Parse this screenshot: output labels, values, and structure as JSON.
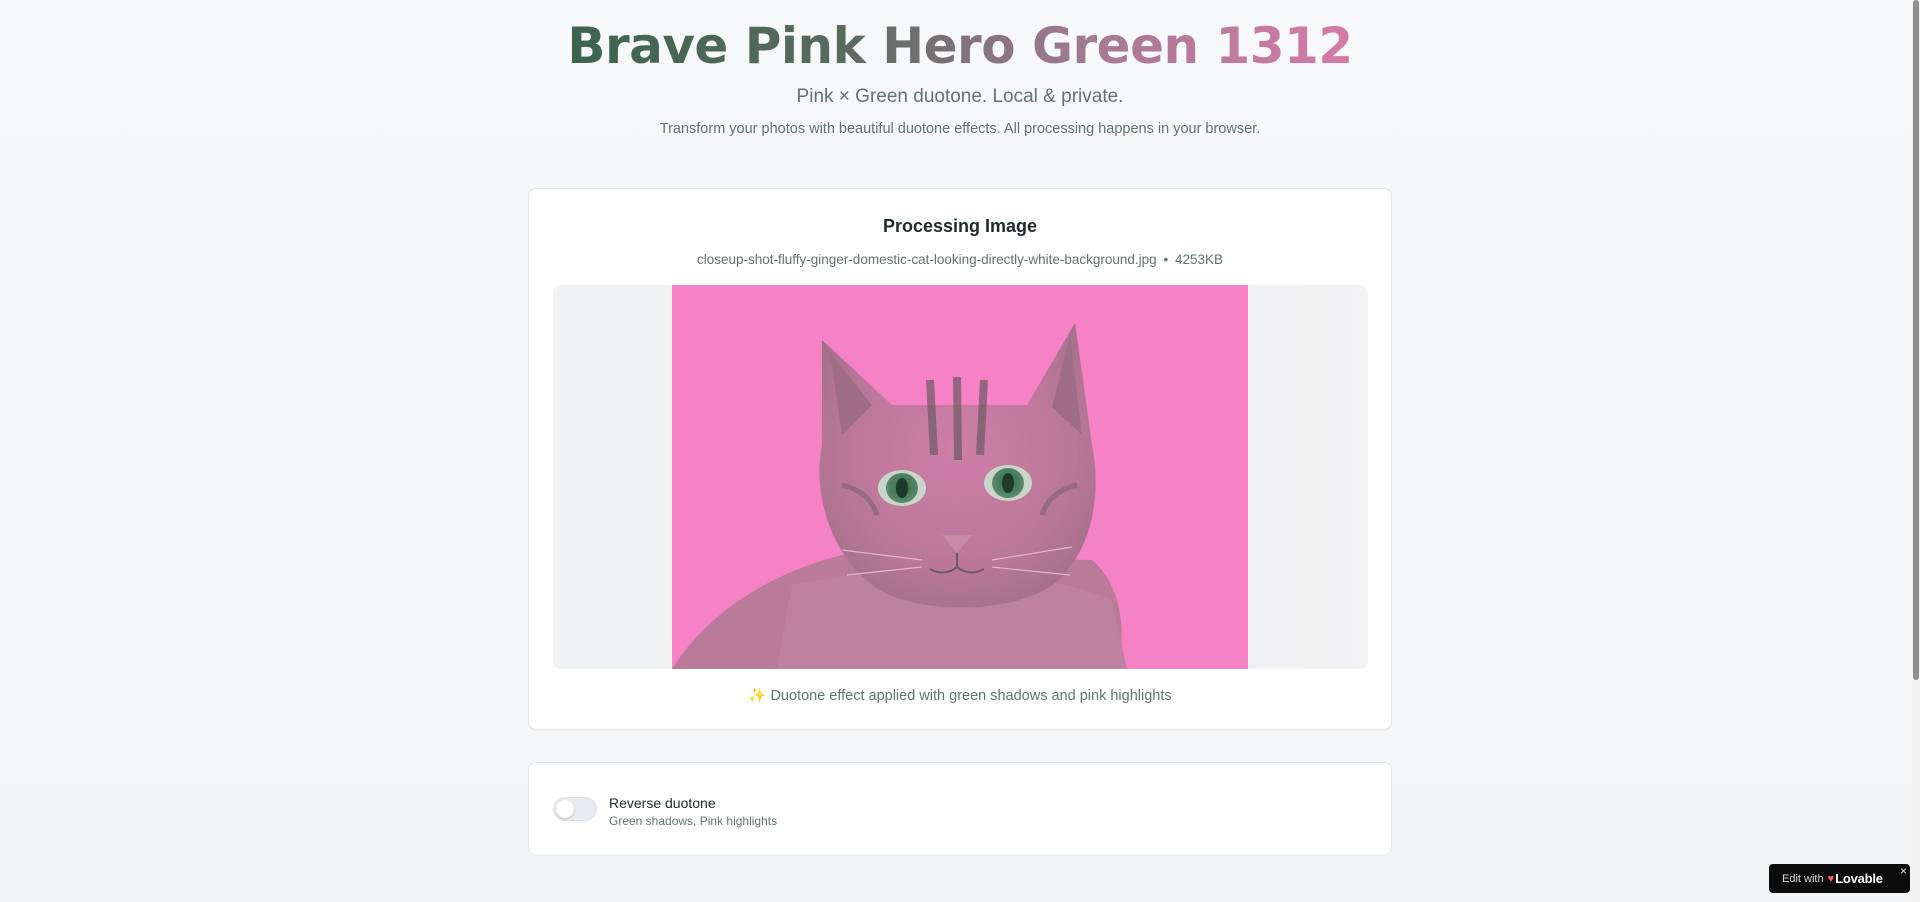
{
  "header": {
    "title": "Brave Pink Hero Green 1312",
    "tagline": "Pink × Green duotone. Local & private.",
    "description": "Transform your photos with beautiful duotone effects. All processing happens in your browser."
  },
  "processing": {
    "title": "Processing Image",
    "file_name": "closeup-shot-fluffy-ginger-domestic-cat-looking-directly-white-background.jpg",
    "separator": "•",
    "file_size": "4253KB",
    "caption_icon": "✨",
    "caption": "Duotone effect applied with green shadows and pink highlights",
    "image_alt": "cat"
  },
  "settings": {
    "toggle_label": "Reverse duotone",
    "toggle_hint": "Green shadows, Pink highlights",
    "toggle_on": false
  },
  "badge": {
    "prefix": "Edit with",
    "brand": "Lovable",
    "close": "×"
  },
  "colors": {
    "pink": "#f582c4",
    "green": "#3c6450",
    "text_muted": "#61756c"
  },
  "icons": {
    "sparkle": "sparkle-icon",
    "heart": "heart-icon",
    "close": "close-icon"
  }
}
